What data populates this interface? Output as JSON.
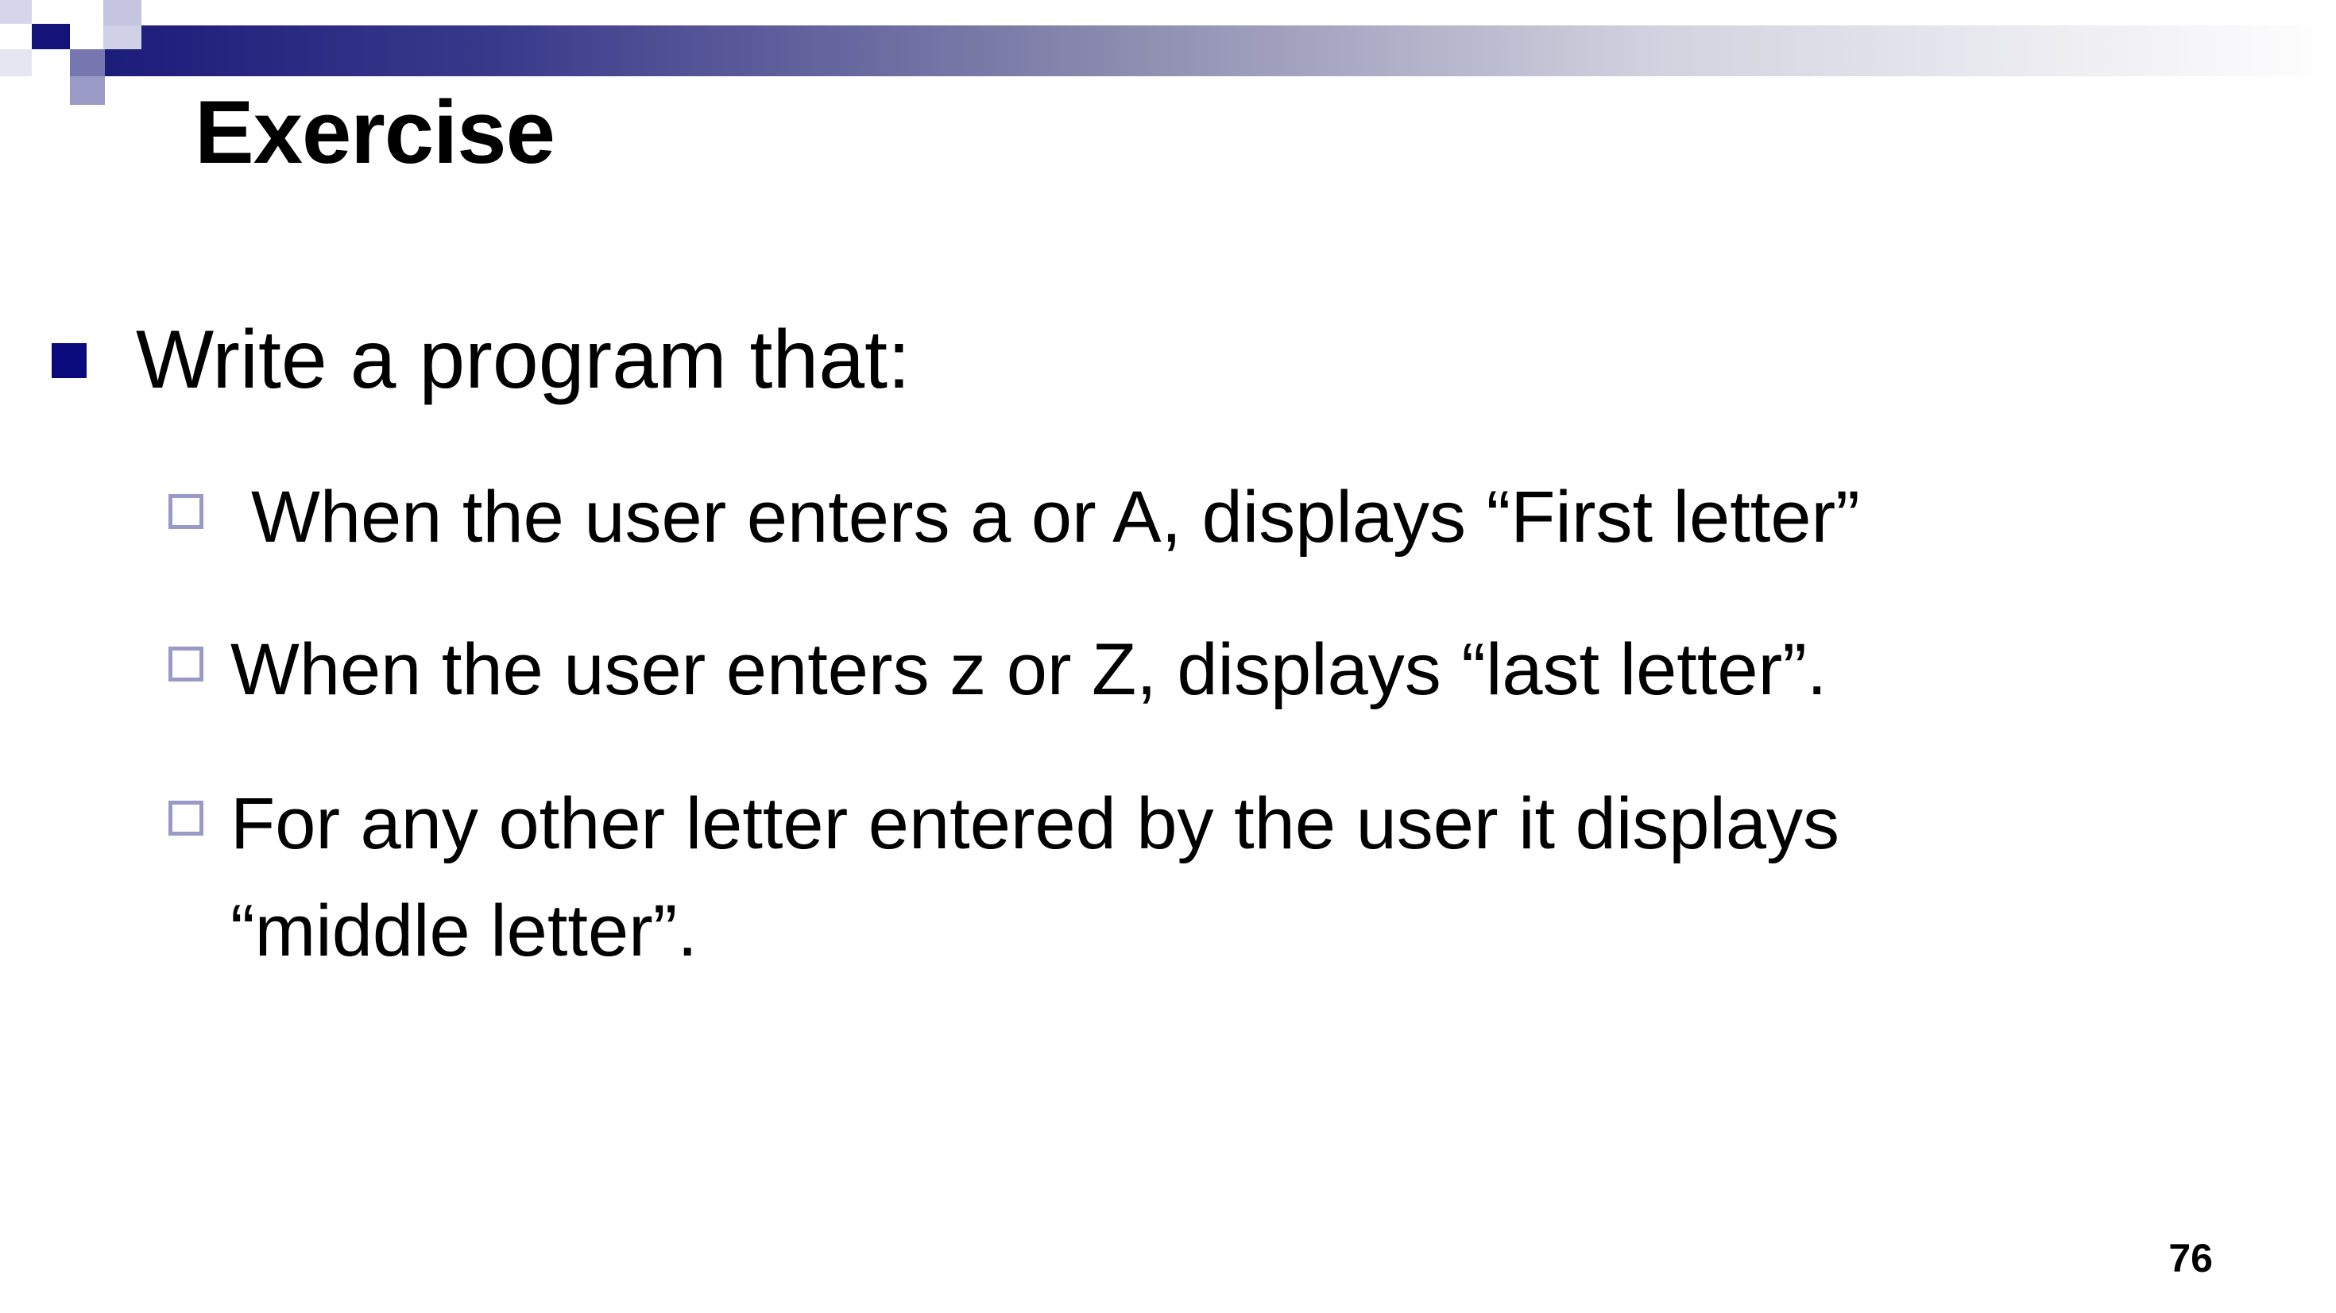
{
  "slide": {
    "title": "Exercise",
    "bullets": [
      {
        "text": "Write a program that:",
        "sub_bullets": [
          {
            "text": "When the user enters a or A,  displays “First letter”"
          },
          {
            "text": "When the user enters z or Z, displays “last letter”."
          },
          {
            "text": "For any other letter entered by the user it displays “middle letter”."
          }
        ]
      }
    ],
    "page_number": "76"
  },
  "theme": {
    "accent": "#0a0a7c",
    "sub_bullet_color": "#9a9ac8",
    "gradient_start": "#1c1c7a"
  }
}
